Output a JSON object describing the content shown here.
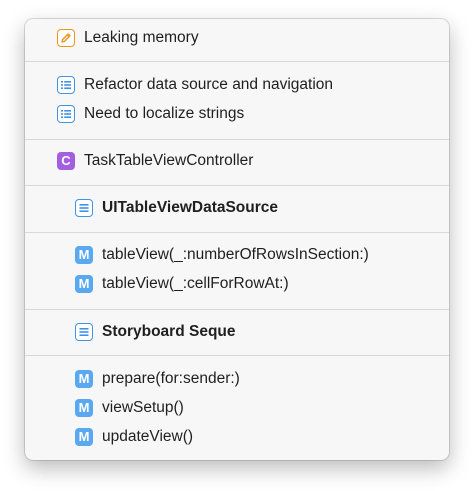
{
  "popover": {
    "items": [
      {
        "label": "Leaking memory",
        "icon": "pencil-icon"
      },
      {
        "label": "Refactor data source and navigation",
        "icon": "list-icon"
      },
      {
        "label": "Need to localize strings",
        "icon": "list-icon"
      },
      {
        "label": "TaskTableViewController",
        "icon": "class-icon",
        "icon_letter": "C"
      },
      {
        "label": "UITableViewDataSource",
        "icon": "section-icon"
      },
      {
        "label": "tableView(_:numberOfRowsInSection:)",
        "icon": "method-icon",
        "icon_letter": "M"
      },
      {
        "label": "tableView(_:cellForRowAt:)",
        "icon": "method-icon",
        "icon_letter": "M"
      },
      {
        "label": "Storyboard Seque",
        "icon": "section-icon"
      },
      {
        "label": "prepare(for:sender:)",
        "icon": "method-icon",
        "icon_letter": "M"
      },
      {
        "label": "viewSetup()",
        "icon": "method-icon",
        "icon_letter": "M"
      },
      {
        "label": "updateView()",
        "icon": "method-icon",
        "icon_letter": "M"
      }
    ]
  },
  "colors": {
    "method_icon": "#5aa9f0",
    "class_icon": "#a45ee0",
    "list_icon": "#3f93e6",
    "pencil_icon": "#f0961d"
  }
}
